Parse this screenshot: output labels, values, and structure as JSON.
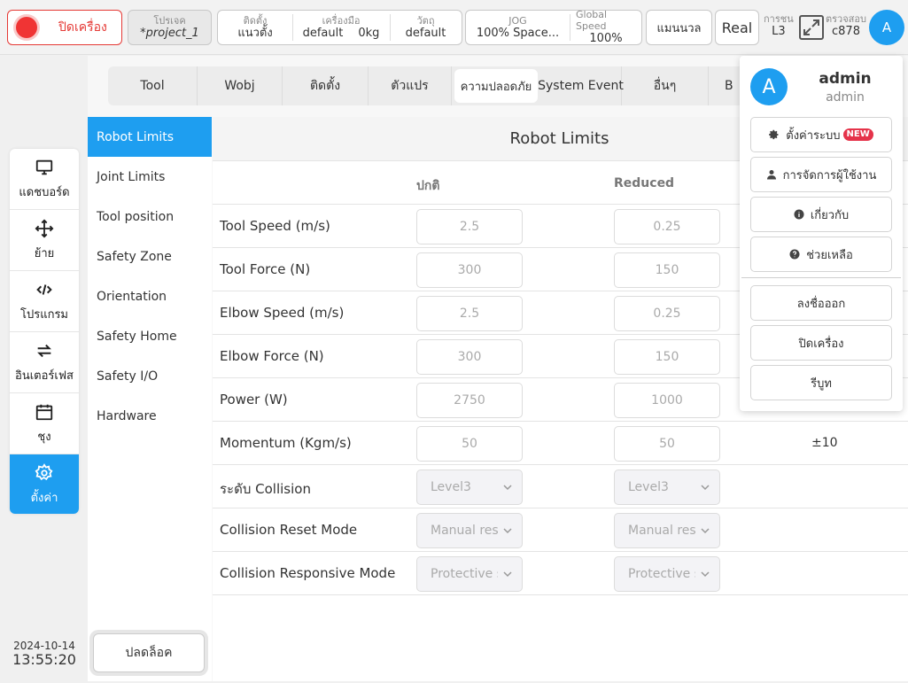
{
  "topbar": {
    "power_label": "ปิดเครื่อง",
    "project_caption": "โปรเจค",
    "project_value": "*project_1",
    "install_caption": "ติดตั้ง",
    "install_value": "แนวตั้ง",
    "tool_caption": "เครื่องมือ",
    "tool_value": "default",
    "tool_weight": "0kg",
    "payload_caption": "วัตถุ",
    "payload_value": "default",
    "jog_caption": "JOG",
    "jog_value": "100%  Space...",
    "speed_caption": "Global Speed",
    "speed_value": "100%",
    "mode_label": "แมนนวล",
    "real_label": "Real",
    "collision_caption": "การชน",
    "collision_value": "L3",
    "check_caption": "ตรวจสอบ",
    "check_value": "c878",
    "avatar_letter": "A"
  },
  "leftnav": {
    "items": [
      {
        "label": "แดชบอร์ด",
        "icon": "monitor-icon"
      },
      {
        "label": "ย้าย",
        "icon": "move-icon"
      },
      {
        "label": "โปรแกรม",
        "icon": "code-icon"
      },
      {
        "label": "อินเตอร์เฟส",
        "icon": "swap-icon"
      },
      {
        "label": "ชุง",
        "icon": "calendar-icon"
      },
      {
        "label": "ตั้งค่า",
        "icon": "gear-icon"
      }
    ],
    "active_index": 5
  },
  "datetime": {
    "date": "2024-10-14",
    "time": "13:55:20"
  },
  "tabs": [
    "Tool",
    "Wobj",
    "ติดตั้ง",
    "ตัวแปร",
    "ความปลอดภัย",
    "System Event",
    "อื่นๆ",
    "B"
  ],
  "active_tab": "ความปลอดภัย",
  "subnav": {
    "items": [
      "Robot Limits",
      "Joint Limits",
      "Tool position",
      "Safety Zone",
      "Orientation",
      "Safety Home",
      "Safety I/O",
      "Hardware"
    ],
    "active": "Robot Limits",
    "unlock_label": "ปลดล็อค"
  },
  "content": {
    "title": "Robot Limits",
    "col_normal": "ปกติ",
    "col_reduced": "Reduced",
    "rows": [
      {
        "label": "Tool Speed  (m/s)",
        "normal": "2.5",
        "reduced": "0.25",
        "tolerance": ""
      },
      {
        "label": "Tool Force  (N)",
        "normal": "300",
        "reduced": "150",
        "tolerance": ""
      },
      {
        "label": "Elbow Speed  (m/s)",
        "normal": "2.5",
        "reduced": "0.25",
        "tolerance": ""
      },
      {
        "label": "Elbow Force  (N)",
        "normal": "300",
        "reduced": "150",
        "tolerance": ""
      },
      {
        "label": "Power  (W)",
        "normal": "2750",
        "reduced": "1000",
        "tolerance": ""
      },
      {
        "label": "Momentum  (Kgm/s)",
        "normal": "50",
        "reduced": "50",
        "tolerance": "±10"
      }
    ],
    "select_rows": [
      {
        "label": "ระดับ Collision",
        "normal": "Level3",
        "reduced": "Level3"
      },
      {
        "label": "Collision Reset Mode",
        "normal": "Manual reset",
        "reduced": "Manual reset"
      },
      {
        "label": "Collision Responsive Mode",
        "normal": "Protective stop",
        "reduced": "Protective stop"
      }
    ]
  },
  "user_menu": {
    "avatar_letter": "A",
    "name": "admin",
    "role": "admin",
    "settings_label": "ตั้งค่าระบบ",
    "new_badge": "NEW",
    "user_mgmt_label": "การจัดการผู้ใช้งาน",
    "about_label": "เกี่ยวกับ",
    "help_label": "ช่วยเหลือ",
    "logout_label": "ลงชื่อออก",
    "shutdown_label": "ปิดเครื่อง",
    "reboot_label": "รีบูท"
  },
  "colors": {
    "accent": "#1e9ef0",
    "danger": "#e53935",
    "badge": "#e5334a"
  }
}
